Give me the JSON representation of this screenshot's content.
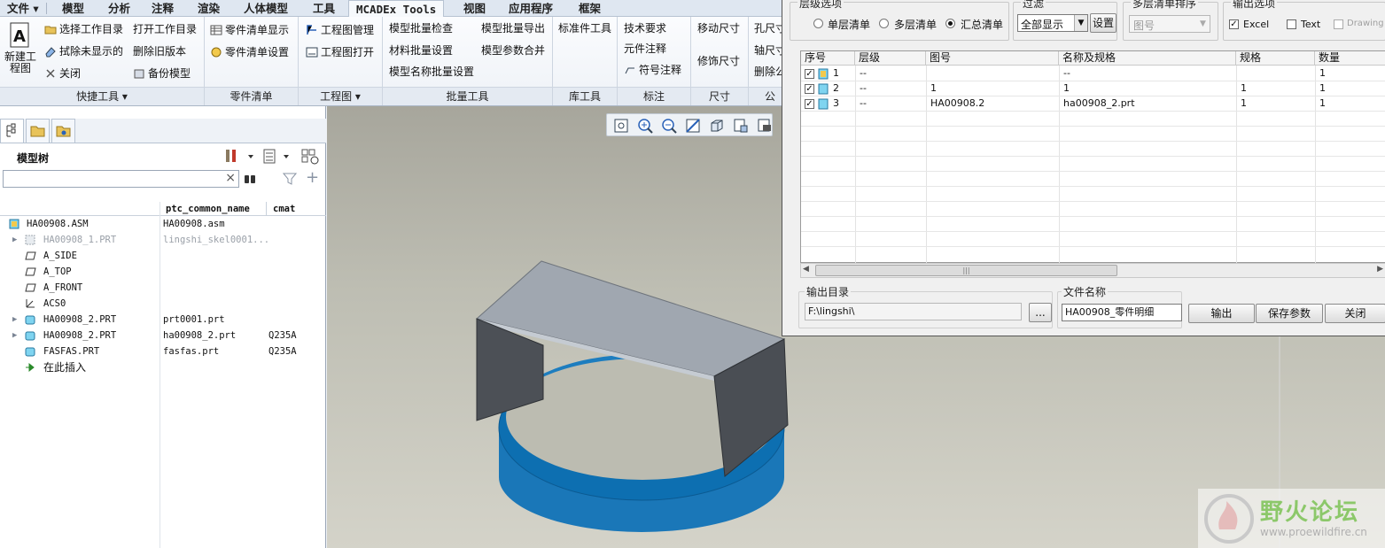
{
  "menubar": {
    "file": "文件",
    "items": [
      "模型",
      "分析",
      "注释",
      "渲染",
      "人体模型",
      "工具",
      "MCADEx Tools",
      "视图",
      "应用程序",
      "框架"
    ],
    "active": "MCADEx Tools"
  },
  "ribbon": {
    "new_label": "新建工程图",
    "quick": {
      "select_dir": "选择工作目录",
      "open_dir": "打开工作目录",
      "erase_hidden": "拭除未显示的",
      "delete_old": "删除旧版本",
      "close": "关闭",
      "backup": "备份模型",
      "group": "快捷工具"
    },
    "bom": {
      "show": "零件清单显示",
      "settings": "零件清单设置",
      "group": "零件清单"
    },
    "drawing": {
      "manage": "工程图管理",
      "open": "工程图打开",
      "group": "工程图"
    },
    "batch": {
      "check": "模型批量检查",
      "export": "模型批量导出",
      "material": "材料批量设置",
      "merge": "模型参数合并",
      "name": "模型名称批量设置",
      "group": "批量工具"
    },
    "library": {
      "std": "标准件工具",
      "group": "库工具"
    },
    "note": {
      "tech": "技术要求",
      "component": "元件注释",
      "symbol": "符号注释",
      "group": "标注"
    },
    "dim": {
      "move": "移动尺寸",
      "trim": "修饰尺寸",
      "group": "尺寸"
    },
    "tol": {
      "hole": "孔尺寸",
      "axis": "轴尺寸",
      "delete": "删除公",
      "group": "公差"
    }
  },
  "model_tree": {
    "title": "模型树",
    "search_placeholder": "",
    "columns": [
      "ptc_common_name",
      "cmat"
    ],
    "rows": [
      {
        "name": "HA00908.ASM",
        "common": "HA00908.asm",
        "cmat": ""
      },
      {
        "name": "HA00908_1.PRT",
        "common": "lingshi_skel0001...",
        "cmat": ""
      },
      {
        "name": "A_SIDE",
        "common": "",
        "cmat": ""
      },
      {
        "name": "A_TOP",
        "common": "",
        "cmat": ""
      },
      {
        "name": "A_FRONT",
        "common": "",
        "cmat": ""
      },
      {
        "name": "ACS0",
        "common": "",
        "cmat": ""
      },
      {
        "name": "HA00908_2.PRT",
        "common": "prt0001.prt",
        "cmat": ""
      },
      {
        "name": "HA00908_2.PRT",
        "common": "ha00908_2.prt",
        "cmat": "Q235A"
      },
      {
        "name": "FASFAS.PRT",
        "common": "fasfas.prt",
        "cmat": "Q235A"
      },
      {
        "name": "在此插入",
        "common": "",
        "cmat": ""
      }
    ]
  },
  "dialog": {
    "level": {
      "title": "层级选项",
      "single": "单层清单",
      "multi": "多层清单",
      "summary": "汇总清单",
      "selected": "summary"
    },
    "filter": {
      "title": "过滤",
      "value": "全部显示",
      "settings": "设置"
    },
    "sort": {
      "title": "多层清单排序",
      "value": "图号"
    },
    "output": {
      "title": "输出选项",
      "excel": "Excel",
      "text": "Text",
      "drawing": "Drawing",
      "excel_checked": true
    },
    "grid": {
      "headers": [
        "序号",
        "层级",
        "图号",
        "名称及规格",
        "规格",
        "数量"
      ],
      "rows": [
        {
          "no": "1",
          "level": "--",
          "drawing_no": "",
          "name": "--",
          "spec": "",
          "qty": "1"
        },
        {
          "no": "2",
          "level": "--",
          "drawing_no": "1",
          "name": "1",
          "spec": "1",
          "qty": "1"
        },
        {
          "no": "3",
          "level": "--",
          "drawing_no": "HA00908.2",
          "name": "ha00908_2.prt",
          "spec": "1",
          "qty": "1"
        }
      ]
    },
    "out_dir": {
      "title": "输出目录",
      "value": "F:\\lingshi\\",
      "browse": "..."
    },
    "file_name": {
      "title": "文件名称",
      "value": "HA00908_零件明细"
    },
    "buttons": {
      "export": "输出",
      "save": "保存参数",
      "close": "关闭"
    }
  },
  "watermark": {
    "title": "野火论坛",
    "url": "www.proewildfire.cn"
  }
}
